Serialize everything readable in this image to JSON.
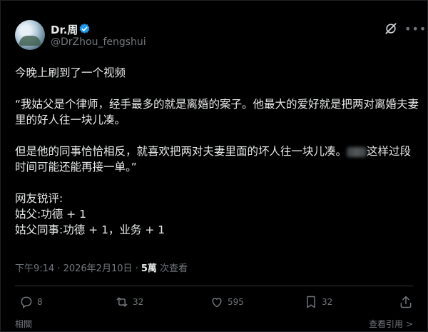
{
  "user": {
    "name": "Dr.周",
    "handle": "@DrZhou_fengshui"
  },
  "tweet": {
    "line1": "今晚上刷到了一个视频",
    "para1": "“我姑父是个律师，经手最多的就是离婚的案子。他最大的爱好就是把两对离婚夫妻里的好人往一块儿凑。",
    "para2_a": "但是他的同事恰恰相反，就喜欢把两对夫妻里面的坏人往一块儿凑。",
    "para2_b": "这样过段时间可能还能再接一单。”",
    "comment_head": "网友锐评:",
    "comment_1": "姑父:功德 + 1",
    "comment_2": "姑父同事:功德 + 1，业务 + 1"
  },
  "meta": {
    "time": "下午9:14 · 2026年2月10日 · ",
    "views_count": "5萬",
    "views_label": " 次查看"
  },
  "actions": {
    "replies": "8",
    "retweets": "32",
    "likes": "595",
    "bookmarks": "32"
  },
  "footer": {
    "left": "相關",
    "right": "查看引用 >"
  },
  "colors": {
    "background": "#000000",
    "text": "#e7e9ea",
    "muted": "#71767b",
    "verified": "#1d9bf0"
  }
}
